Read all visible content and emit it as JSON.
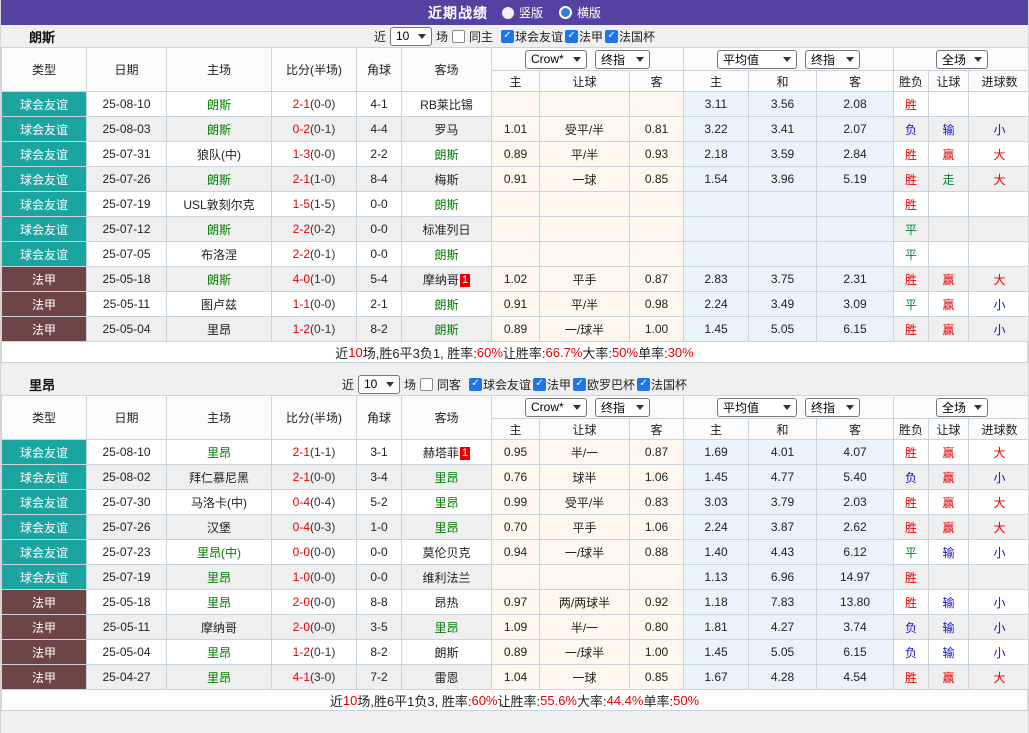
{
  "title_bar": {
    "title": "近期战绩",
    "layout_options": [
      {
        "label": "竖版",
        "state": ""
      },
      {
        "label": "横版",
        "state": "checked"
      }
    ]
  },
  "labels": {
    "recent_prefix": "近",
    "recent_suffix": "场"
  },
  "selects": {
    "recent_count": "10",
    "odds_source": "Crow*",
    "odds_final": "终指",
    "avg_source": "平均值",
    "avg_final": "终指",
    "scope": "全场"
  },
  "columns": {
    "type": "类型",
    "date": "日期",
    "home": "主场",
    "score": "比分(半场)",
    "corner": "角球",
    "away": "客场",
    "odds_home": "主",
    "odds_line": "让球",
    "odds_away": "客",
    "avg_home": "主",
    "avg_draw": "和",
    "avg_away": "客",
    "result_wdl": "胜负",
    "result_handicap": "让球",
    "result_goals": "进球数"
  },
  "colors": {
    "accent_purple": "#5541a0",
    "friendly_teal": "#1ba5a1",
    "league_maroon": "#6e4444",
    "win_red": "#e60000",
    "draw_green": "#008833",
    "lose_blue": "#1414cc",
    "team_green": "#008000",
    "checkbox_blue": "#1e76e8"
  },
  "sections": [
    {
      "team": "朗斯",
      "same_label": "同主",
      "competitions": [
        {
          "label": "球会友谊",
          "state": "checked"
        },
        {
          "label": "法甲",
          "state": "checked"
        },
        {
          "label": "法国杯",
          "state": "checked"
        }
      ],
      "rows": [
        {
          "type": "球会友谊",
          "type_cls": "comp-friendly",
          "date": "25-08-10",
          "home": "朗斯",
          "home_cls": "team-self",
          "home_badge": "",
          "score_ft": "2-1",
          "score_ht": "(0-0)",
          "corner": "4-1",
          "away": "RB莱比锡",
          "away_cls": "",
          "away_badge": "",
          "odds_home": "",
          "odds_line": "",
          "odds_away": "",
          "avg_home": "3.11",
          "avg_draw": "3.56",
          "avg_away": "2.08",
          "res_wdl": "胜",
          "res_wdl_s": "win",
          "res_let": "",
          "res_let_s": "",
          "res_goal": "",
          "res_goal_s": ""
        },
        {
          "type": "球会友谊",
          "type_cls": "comp-friendly",
          "date": "25-08-03",
          "home": "朗斯",
          "home_cls": "team-self",
          "home_badge": "",
          "score_ft": "0-2",
          "score_ht": "(0-1)",
          "corner": "4-4",
          "away": "罗马",
          "away_cls": "",
          "away_badge": "",
          "odds_home": "1.01",
          "odds_line": "受平/半",
          "odds_away": "0.81",
          "avg_home": "3.22",
          "avg_draw": "3.41",
          "avg_away": "2.07",
          "res_wdl": "负",
          "res_wdl_s": "lose",
          "res_let": "输",
          "res_let_s": "fail",
          "res_goal": "小",
          "res_goal_s": "under"
        },
        {
          "type": "球会友谊",
          "type_cls": "comp-friendly",
          "date": "25-07-31",
          "home": "狼队(中)",
          "home_cls": "",
          "home_badge": "",
          "score_ft": "1-3",
          "score_ht": "(0-0)",
          "corner": "2-2",
          "away": "朗斯",
          "away_cls": "team-self",
          "away_badge": "",
          "odds_home": "0.89",
          "odds_line": "平/半",
          "odds_away": "0.93",
          "avg_home": "2.18",
          "avg_draw": "3.59",
          "avg_away": "2.84",
          "res_wdl": "胜",
          "res_wdl_s": "win",
          "res_let": "赢",
          "res_let_s": "cover",
          "res_goal": "大",
          "res_goal_s": "over"
        },
        {
          "type": "球会友谊",
          "type_cls": "comp-friendly",
          "date": "25-07-26",
          "home": "朗斯",
          "home_cls": "team-self",
          "home_badge": "",
          "score_ft": "2-1",
          "score_ht": "(1-0)",
          "corner": "8-4",
          "away": "梅斯",
          "away_cls": "",
          "away_badge": "",
          "odds_home": "0.91",
          "odds_line": "一球",
          "odds_away": "0.85",
          "avg_home": "1.54",
          "avg_draw": "3.96",
          "avg_away": "5.19",
          "res_wdl": "胜",
          "res_wdl_s": "win",
          "res_let": "走",
          "res_let_s": "push",
          "res_goal": "大",
          "res_goal_s": "over"
        },
        {
          "type": "球会友谊",
          "type_cls": "comp-friendly",
          "date": "25-07-19",
          "home": "USL敦刻尔克",
          "home_cls": "",
          "home_badge": "",
          "score_ft": "1-5",
          "score_ht": "(1-5)",
          "corner": "0-0",
          "away": "朗斯",
          "away_cls": "team-self",
          "away_badge": "",
          "odds_home": "",
          "odds_line": "",
          "odds_away": "",
          "avg_home": "",
          "avg_draw": "",
          "avg_away": "",
          "res_wdl": "胜",
          "res_wdl_s": "win",
          "res_let": "",
          "res_let_s": "",
          "res_goal": "",
          "res_goal_s": ""
        },
        {
          "type": "球会友谊",
          "type_cls": "comp-friendly",
          "date": "25-07-12",
          "home": "朗斯",
          "home_cls": "team-self",
          "home_badge": "",
          "score_ft": "2-2",
          "score_ht": "(0-2)",
          "corner": "0-0",
          "away": "标准列日",
          "away_cls": "",
          "away_badge": "",
          "odds_home": "",
          "odds_line": "",
          "odds_away": "",
          "avg_home": "",
          "avg_draw": "",
          "avg_away": "",
          "res_wdl": "平",
          "res_wdl_s": "draw",
          "res_let": "",
          "res_let_s": "",
          "res_goal": "",
          "res_goal_s": ""
        },
        {
          "type": "球会友谊",
          "type_cls": "comp-friendly",
          "date": "25-07-05",
          "home": "布洛涅",
          "home_cls": "",
          "home_badge": "",
          "score_ft": "2-2",
          "score_ht": "(0-1)",
          "corner": "0-0",
          "away": "朗斯",
          "away_cls": "team-self",
          "away_badge": "",
          "odds_home": "",
          "odds_line": "",
          "odds_away": "",
          "avg_home": "",
          "avg_draw": "",
          "avg_away": "",
          "res_wdl": "平",
          "res_wdl_s": "draw",
          "res_let": "",
          "res_let_s": "",
          "res_goal": "",
          "res_goal_s": ""
        },
        {
          "type": "法甲",
          "type_cls": "comp-league",
          "date": "25-05-18",
          "home": "朗斯",
          "home_cls": "team-self",
          "home_badge": "",
          "score_ft": "4-0",
          "score_ht": "(1-0)",
          "corner": "5-4",
          "away": "摩纳哥",
          "away_cls": "",
          "away_badge": "1",
          "odds_home": "1.02",
          "odds_line": "平手",
          "odds_away": "0.87",
          "avg_home": "2.83",
          "avg_draw": "3.75",
          "avg_away": "2.31",
          "res_wdl": "胜",
          "res_wdl_s": "win",
          "res_let": "赢",
          "res_let_s": "cover",
          "res_goal": "大",
          "res_goal_s": "over"
        },
        {
          "type": "法甲",
          "type_cls": "comp-league",
          "date": "25-05-11",
          "home": "图卢兹",
          "home_cls": "",
          "home_badge": "",
          "score_ft": "1-1",
          "score_ht": "(0-0)",
          "corner": "2-1",
          "away": "朗斯",
          "away_cls": "team-self",
          "away_badge": "",
          "odds_home": "0.91",
          "odds_line": "平/半",
          "odds_away": "0.98",
          "avg_home": "2.24",
          "avg_draw": "3.49",
          "avg_away": "3.09",
          "res_wdl": "平",
          "res_wdl_s": "draw",
          "res_let": "赢",
          "res_let_s": "cover",
          "res_goal": "小",
          "res_goal_s": "under"
        },
        {
          "type": "法甲",
          "type_cls": "comp-league",
          "date": "25-05-04",
          "home": "里昂",
          "home_cls": "",
          "home_badge": "",
          "score_ft": "1-2",
          "score_ht": "(0-1)",
          "corner": "8-2",
          "away": "朗斯",
          "away_cls": "team-self",
          "away_badge": "",
          "odds_home": "0.89",
          "odds_line": "一/球半",
          "odds_away": "1.00",
          "avg_home": "1.45",
          "avg_draw": "5.05",
          "avg_away": "6.15",
          "res_wdl": "胜",
          "res_wdl_s": "win",
          "res_let": "赢",
          "res_let_s": "cover",
          "res_goal": "小",
          "res_goal_s": "under"
        }
      ],
      "summary": [
        {
          "t": "近",
          "c": ""
        },
        {
          "t": "10",
          "c": "red"
        },
        {
          "t": "场,胜6平3负1, 胜率:",
          "c": ""
        },
        {
          "t": "60%",
          "c": "red"
        },
        {
          "t": " 让胜率:",
          "c": ""
        },
        {
          "t": "66.7%",
          "c": "red"
        },
        {
          "t": " 大率:",
          "c": ""
        },
        {
          "t": "50%",
          "c": "red"
        },
        {
          "t": " 单率:",
          "c": ""
        },
        {
          "t": "30%",
          "c": "red"
        }
      ]
    },
    {
      "team": "里昂",
      "same_label": "同客",
      "competitions": [
        {
          "label": "球会友谊",
          "state": "checked"
        },
        {
          "label": "法甲",
          "state": "checked"
        },
        {
          "label": "欧罗巴杯",
          "state": "checked"
        },
        {
          "label": "法国杯",
          "state": "checked"
        }
      ],
      "rows": [
        {
          "type": "球会友谊",
          "type_cls": "comp-friendly",
          "date": "25-08-10",
          "home": "里昂",
          "home_cls": "team-self",
          "home_badge": "",
          "score_ft": "2-1",
          "score_ht": "(1-1)",
          "corner": "3-1",
          "away": "赫塔菲",
          "away_cls": "",
          "away_badge": "1",
          "odds_home": "0.95",
          "odds_line": "半/一",
          "odds_away": "0.87",
          "avg_home": "1.69",
          "avg_draw": "4.01",
          "avg_away": "4.07",
          "res_wdl": "胜",
          "res_wdl_s": "win",
          "res_let": "赢",
          "res_let_s": "cover",
          "res_goal": "大",
          "res_goal_s": "over"
        },
        {
          "type": "球会友谊",
          "type_cls": "comp-friendly",
          "date": "25-08-02",
          "home": "拜仁慕尼黑",
          "home_cls": "",
          "home_badge": "",
          "score_ft": "2-1",
          "score_ht": "(0-0)",
          "corner": "3-4",
          "away": "里昂",
          "away_cls": "team-self",
          "away_badge": "",
          "odds_home": "0.76",
          "odds_line": "球半",
          "odds_away": "1.06",
          "avg_home": "1.45",
          "avg_draw": "4.77",
          "avg_away": "5.40",
          "res_wdl": "负",
          "res_wdl_s": "lose",
          "res_let": "赢",
          "res_let_s": "cover",
          "res_goal": "小",
          "res_goal_s": "under"
        },
        {
          "type": "球会友谊",
          "type_cls": "comp-friendly",
          "date": "25-07-30",
          "home": "马洛卡(中)",
          "home_cls": "",
          "home_badge": "",
          "score_ft": "0-4",
          "score_ht": "(0-4)",
          "corner": "5-2",
          "away": "里昂",
          "away_cls": "team-self",
          "away_badge": "",
          "odds_home": "0.99",
          "odds_line": "受平/半",
          "odds_away": "0.83",
          "avg_home": "3.03",
          "avg_draw": "3.79",
          "avg_away": "2.03",
          "res_wdl": "胜",
          "res_wdl_s": "win",
          "res_let": "赢",
          "res_let_s": "cover",
          "res_goal": "大",
          "res_goal_s": "over"
        },
        {
          "type": "球会友谊",
          "type_cls": "comp-friendly",
          "date": "25-07-26",
          "home": "汉堡",
          "home_cls": "",
          "home_badge": "",
          "score_ft": "0-4",
          "score_ht": "(0-3)",
          "corner": "1-0",
          "away": "里昂",
          "away_cls": "team-self",
          "away_badge": "",
          "odds_home": "0.70",
          "odds_line": "平手",
          "odds_away": "1.06",
          "avg_home": "2.24",
          "avg_draw": "3.87",
          "avg_away": "2.62",
          "res_wdl": "胜",
          "res_wdl_s": "win",
          "res_let": "赢",
          "res_let_s": "cover",
          "res_goal": "大",
          "res_goal_s": "over"
        },
        {
          "type": "球会友谊",
          "type_cls": "comp-friendly",
          "date": "25-07-23",
          "home": "里昂(中)",
          "home_cls": "team-self",
          "home_badge": "",
          "score_ft": "0-0",
          "score_ht": "(0-0)",
          "corner": "0-0",
          "away": "莫伦贝克",
          "away_cls": "",
          "away_badge": "",
          "odds_home": "0.94",
          "odds_line": "一/球半",
          "odds_away": "0.88",
          "avg_home": "1.40",
          "avg_draw": "4.43",
          "avg_away": "6.12",
          "res_wdl": "平",
          "res_wdl_s": "draw",
          "res_let": "输",
          "res_let_s": "fail",
          "res_goal": "小",
          "res_goal_s": "under"
        },
        {
          "type": "球会友谊",
          "type_cls": "comp-friendly",
          "date": "25-07-19",
          "home": "里昂",
          "home_cls": "team-self",
          "home_badge": "",
          "score_ft": "1-0",
          "score_ht": "(0-0)",
          "corner": "0-0",
          "away": "维利法兰",
          "away_cls": "",
          "away_badge": "",
          "odds_home": "",
          "odds_line": "",
          "odds_away": "",
          "avg_home": "1.13",
          "avg_draw": "6.96",
          "avg_away": "14.97",
          "res_wdl": "胜",
          "res_wdl_s": "win",
          "res_let": "",
          "res_let_s": "",
          "res_goal": "",
          "res_goal_s": ""
        },
        {
          "type": "法甲",
          "type_cls": "comp-league",
          "date": "25-05-18",
          "home": "里昂",
          "home_cls": "team-self",
          "home_badge": "",
          "score_ft": "2-0",
          "score_ht": "(0-0)",
          "corner": "8-8",
          "away": "昂热",
          "away_cls": "",
          "away_badge": "",
          "odds_home": "0.97",
          "odds_line": "两/两球半",
          "odds_away": "0.92",
          "avg_home": "1.18",
          "avg_draw": "7.83",
          "avg_away": "13.80",
          "res_wdl": "胜",
          "res_wdl_s": "win",
          "res_let": "输",
          "res_let_s": "fail",
          "res_goal": "小",
          "res_goal_s": "under"
        },
        {
          "type": "法甲",
          "type_cls": "comp-league",
          "date": "25-05-11",
          "home": "摩纳哥",
          "home_cls": "",
          "home_badge": "",
          "score_ft": "2-0",
          "score_ht": "(0-0)",
          "corner": "3-5",
          "away": "里昂",
          "away_cls": "team-self",
          "away_badge": "",
          "odds_home": "1.09",
          "odds_line": "半/一",
          "odds_away": "0.80",
          "avg_home": "1.81",
          "avg_draw": "4.27",
          "avg_away": "3.74",
          "res_wdl": "负",
          "res_wdl_s": "lose",
          "res_let": "输",
          "res_let_s": "fail",
          "res_goal": "小",
          "res_goal_s": "under"
        },
        {
          "type": "法甲",
          "type_cls": "comp-league",
          "date": "25-05-04",
          "home": "里昂",
          "home_cls": "team-self",
          "home_badge": "",
          "score_ft": "1-2",
          "score_ht": "(0-1)",
          "corner": "8-2",
          "away": "朗斯",
          "away_cls": "",
          "away_badge": "",
          "odds_home": "0.89",
          "odds_line": "一/球半",
          "odds_away": "1.00",
          "avg_home": "1.45",
          "avg_draw": "5.05",
          "avg_away": "6.15",
          "res_wdl": "负",
          "res_wdl_s": "lose",
          "res_let": "输",
          "res_let_s": "fail",
          "res_goal": "小",
          "res_goal_s": "under"
        },
        {
          "type": "法甲",
          "type_cls": "comp-league",
          "date": "25-04-27",
          "home": "里昂",
          "home_cls": "team-self",
          "home_badge": "",
          "score_ft": "4-1",
          "score_ht": "(3-0)",
          "corner": "7-2",
          "away": "雷恩",
          "away_cls": "",
          "away_badge": "",
          "odds_home": "1.04",
          "odds_line": "一球",
          "odds_away": "0.85",
          "avg_home": "1.67",
          "avg_draw": "4.28",
          "avg_away": "4.54",
          "res_wdl": "胜",
          "res_wdl_s": "win",
          "res_let": "赢",
          "res_let_s": "cover",
          "res_goal": "大",
          "res_goal_s": "over"
        }
      ],
      "summary": [
        {
          "t": "近",
          "c": ""
        },
        {
          "t": "10",
          "c": "red"
        },
        {
          "t": "场,胜6平1负3, 胜率:",
          "c": ""
        },
        {
          "t": "60%",
          "c": "red"
        },
        {
          "t": " 让胜率:",
          "c": ""
        },
        {
          "t": "55.6%",
          "c": "red"
        },
        {
          "t": " 大率:",
          "c": ""
        },
        {
          "t": "44.4%",
          "c": "red"
        },
        {
          "t": " 单率:",
          "c": ""
        },
        {
          "t": "50%",
          "c": "red"
        }
      ]
    }
  ]
}
